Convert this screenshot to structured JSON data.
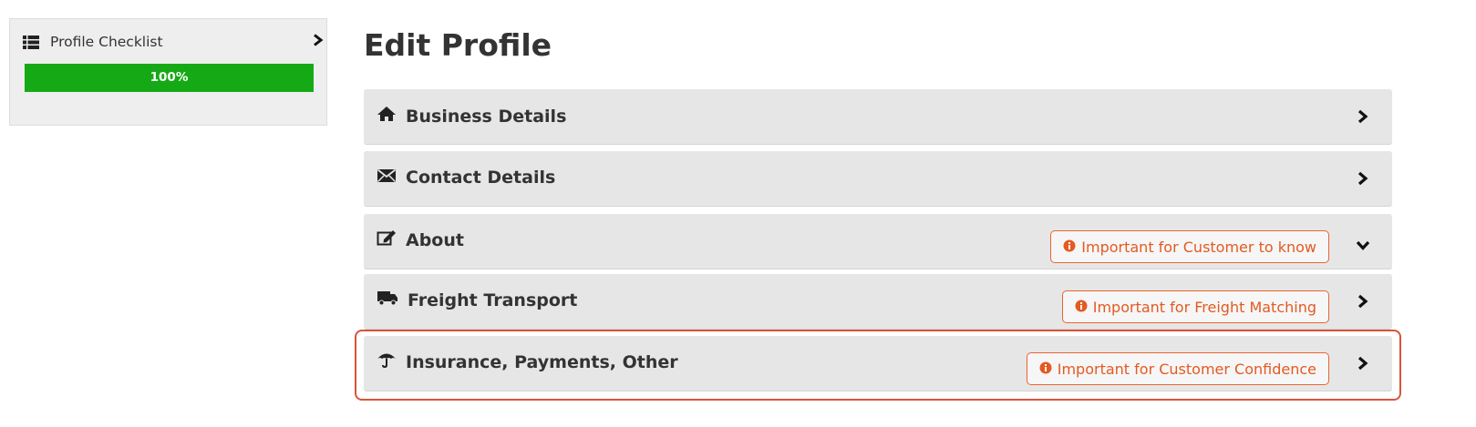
{
  "sidebar": {
    "checklist_label": "Profile Checklist",
    "progress_label": "100%",
    "progress_value": 1.0,
    "progress_color": "#16a916"
  },
  "page_title": "Edit Profile",
  "panels": [
    {
      "title": "Business Details",
      "icon": "home-icon",
      "chevron": "chevron-right"
    },
    {
      "title": "Contact Details",
      "icon": "envelope-icon",
      "chevron": "chevron-right"
    },
    {
      "title": "About",
      "icon": "edit-icon",
      "chevron": "chevron-down",
      "badge": "Important for Customer to know"
    },
    {
      "title": "Freight Transport",
      "icon": "truck-icon",
      "chevron": "chevron-right",
      "badge": "Important for Freight Matching"
    },
    {
      "title": "Insurance, Payments, Other",
      "icon": "umbrella-icon",
      "chevron": "chevron-right",
      "badge": "Important for Customer Confidence",
      "highlighted": true
    }
  ],
  "colors": {
    "badge_text": "#e35a22",
    "badge_border": "#e9652f",
    "highlight_border": "#d9543a",
    "panel_bg": "#e6e6e6"
  }
}
